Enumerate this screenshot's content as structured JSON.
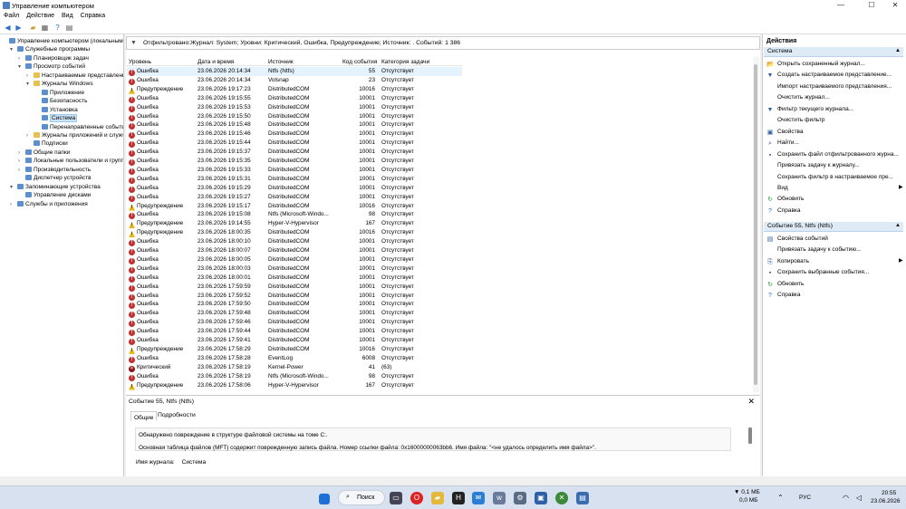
{
  "window": {
    "title": "Управление компьютером",
    "minimize": "—",
    "maximize": "☐",
    "close": "✕"
  },
  "menu": [
    "Файл",
    "Действие",
    "Вид",
    "Справка"
  ],
  "tree": [
    {
      "label": "Управление компьютером (локальным)",
      "level": 0,
      "arrow": "",
      "icon": "computer-icon"
    },
    {
      "label": "Служебные программы",
      "level": 1,
      "arrow": "▾",
      "icon": "tools-icon"
    },
    {
      "label": "Планировщик задач",
      "level": 2,
      "arrow": "›",
      "icon": "clock-icon"
    },
    {
      "label": "Просмотр событий",
      "level": 2,
      "arrow": "▾",
      "icon": "event-viewer-icon"
    },
    {
      "label": "Настраиваемые представления",
      "level": 3,
      "arrow": "›",
      "icon": "folder-icon"
    },
    {
      "label": "Журналы Windows",
      "level": 3,
      "arrow": "▾",
      "icon": "folder-icon"
    },
    {
      "label": "Приложение",
      "level": 4,
      "arrow": "",
      "icon": "log-icon"
    },
    {
      "label": "Безопасность",
      "level": 4,
      "arrow": "",
      "icon": "log-icon"
    },
    {
      "label": "Установка",
      "level": 4,
      "arrow": "",
      "icon": "log-icon"
    },
    {
      "label": "Система",
      "level": 4,
      "arrow": "",
      "icon": "log-icon",
      "selected": true
    },
    {
      "label": "Перенаправленные события",
      "level": 4,
      "arrow": "",
      "icon": "log-icon"
    },
    {
      "label": "Журналы приложений и служб",
      "level": 3,
      "arrow": "›",
      "icon": "folder-icon"
    },
    {
      "label": "Подписки",
      "level": 3,
      "arrow": "",
      "icon": "subscription-icon"
    },
    {
      "label": "Общие папки",
      "level": 2,
      "arrow": "›",
      "icon": "shared-folder-icon"
    },
    {
      "label": "Локальные пользователи и группы",
      "level": 2,
      "arrow": "›",
      "icon": "users-icon"
    },
    {
      "label": "Производительность",
      "level": 2,
      "arrow": "›",
      "icon": "performance-icon"
    },
    {
      "label": "Диспетчер устройств",
      "level": 2,
      "arrow": "",
      "icon": "device-manager-icon"
    },
    {
      "label": "Запоминающие устройства",
      "level": 1,
      "arrow": "▾",
      "icon": "storage-icon"
    },
    {
      "label": "Управление дисками",
      "level": 2,
      "arrow": "",
      "icon": "disk-icon"
    },
    {
      "label": "Службы и приложения",
      "level": 1,
      "arrow": "›",
      "icon": "services-icon"
    }
  ],
  "filter": {
    "text": "Отфильтровано:Журнал: System; Уровни: Критический, Ошибка, Предупреждение; Источник: . Событий: 1 386"
  },
  "columns": {
    "level": "Уровень",
    "datetime": "Дата и время",
    "source": "Источник",
    "code": "Код события",
    "category": "Категория задачи"
  },
  "rows": [
    {
      "level": "Ошибка",
      "type": "err",
      "dt": "23.06.2026 20:14:34",
      "src": "Ntfs (Ntfs)",
      "code": "55",
      "cat": "Отсутствует",
      "selected": true
    },
    {
      "level": "Ошибка",
      "type": "err",
      "dt": "23.06.2026 20:14:34",
      "src": "Volsnap",
      "code": "23",
      "cat": "Отсутствует"
    },
    {
      "level": "Предупреждение",
      "type": "warn",
      "dt": "23.06.2026 19:17:23",
      "src": "DistributedCOM",
      "code": "10016",
      "cat": "Отсутствует"
    },
    {
      "level": "Ошибка",
      "type": "err",
      "dt": "23.06.2026 19:15:55",
      "src": "DistributedCOM",
      "code": "10001",
      "cat": "Отсутствует"
    },
    {
      "level": "Ошибка",
      "type": "err",
      "dt": "23.06.2026 19:15:53",
      "src": "DistributedCOM",
      "code": "10001",
      "cat": "Отсутствует"
    },
    {
      "level": "Ошибка",
      "type": "err",
      "dt": "23.06.2026 19:15:50",
      "src": "DistributedCOM",
      "code": "10001",
      "cat": "Отсутствует"
    },
    {
      "level": "Ошибка",
      "type": "err",
      "dt": "23.06.2026 19:15:48",
      "src": "DistributedCOM",
      "code": "10001",
      "cat": "Отсутствует"
    },
    {
      "level": "Ошибка",
      "type": "err",
      "dt": "23.06.2026 19:15:46",
      "src": "DistributedCOM",
      "code": "10001",
      "cat": "Отсутствует"
    },
    {
      "level": "Ошибка",
      "type": "err",
      "dt": "23.06.2026 19:15:44",
      "src": "DistributedCOM",
      "code": "10001",
      "cat": "Отсутствует"
    },
    {
      "level": "Ошибка",
      "type": "err",
      "dt": "23.06.2026 19:15:37",
      "src": "DistributedCOM",
      "code": "10001",
      "cat": "Отсутствует"
    },
    {
      "level": "Ошибка",
      "type": "err",
      "dt": "23.06.2026 19:15:35",
      "src": "DistributedCOM",
      "code": "10001",
      "cat": "Отсутствует"
    },
    {
      "level": "Ошибка",
      "type": "err",
      "dt": "23.06.2026 19:15:33",
      "src": "DistributedCOM",
      "code": "10001",
      "cat": "Отсутствует"
    },
    {
      "level": "Ошибка",
      "type": "err",
      "dt": "23.06.2026 19:15:31",
      "src": "DistributedCOM",
      "code": "10001",
      "cat": "Отсутствует"
    },
    {
      "level": "Ошибка",
      "type": "err",
      "dt": "23.06.2026 19:15:29",
      "src": "DistributedCOM",
      "code": "10001",
      "cat": "Отсутствует"
    },
    {
      "level": "Ошибка",
      "type": "err",
      "dt": "23.06.2026 19:15:27",
      "src": "DistributedCOM",
      "code": "10001",
      "cat": "Отсутствует"
    },
    {
      "level": "Предупреждение",
      "type": "warn",
      "dt": "23.06.2026 19:15:17",
      "src": "DistributedCOM",
      "code": "10016",
      "cat": "Отсутствует"
    },
    {
      "level": "Ошибка",
      "type": "err",
      "dt": "23.06.2026 19:15:08",
      "src": "Ntfs (Microsoft-Windo...",
      "code": "98",
      "cat": "Отсутствует"
    },
    {
      "level": "Предупреждение",
      "type": "warn",
      "dt": "23.06.2026 19:14:55",
      "src": "Hyper-V-Hypervisor",
      "code": "167",
      "cat": "Отсутствует"
    },
    {
      "level": "Предупреждение",
      "type": "warn",
      "dt": "23.06.2026 18:00:35",
      "src": "DistributedCOM",
      "code": "10016",
      "cat": "Отсутствует"
    },
    {
      "level": "Ошибка",
      "type": "err",
      "dt": "23.06.2026 18:00:10",
      "src": "DistributedCOM",
      "code": "10001",
      "cat": "Отсутствует"
    },
    {
      "level": "Ошибка",
      "type": "err",
      "dt": "23.06.2026 18:00:07",
      "src": "DistributedCOM",
      "code": "10001",
      "cat": "Отсутствует"
    },
    {
      "level": "Ошибка",
      "type": "err",
      "dt": "23.06.2026 18:00:05",
      "src": "DistributedCOM",
      "code": "10001",
      "cat": "Отсутствует"
    },
    {
      "level": "Ошибка",
      "type": "err",
      "dt": "23.06.2026 18:00:03",
      "src": "DistributedCOM",
      "code": "10001",
      "cat": "Отсутствует"
    },
    {
      "level": "Ошибка",
      "type": "err",
      "dt": "23.06.2026 18:00:01",
      "src": "DistributedCOM",
      "code": "10001",
      "cat": "Отсутствует"
    },
    {
      "level": "Ошибка",
      "type": "err",
      "dt": "23.06.2026 17:59:59",
      "src": "DistributedCOM",
      "code": "10001",
      "cat": "Отсутствует"
    },
    {
      "level": "Ошибка",
      "type": "err",
      "dt": "23.06.2026 17:59:52",
      "src": "DistributedCOM",
      "code": "10001",
      "cat": "Отсутствует"
    },
    {
      "level": "Ошибка",
      "type": "err",
      "dt": "23.06.2026 17:59:50",
      "src": "DistributedCOM",
      "code": "10001",
      "cat": "Отсутствует"
    },
    {
      "level": "Ошибка",
      "type": "err",
      "dt": "23.06.2026 17:59:48",
      "src": "DistributedCOM",
      "code": "10001",
      "cat": "Отсутствует"
    },
    {
      "level": "Ошибка",
      "type": "err",
      "dt": "23.06.2026 17:59:46",
      "src": "DistributedCOM",
      "code": "10001",
      "cat": "Отсутствует"
    },
    {
      "level": "Ошибка",
      "type": "err",
      "dt": "23.06.2026 17:59:44",
      "src": "DistributedCOM",
      "code": "10001",
      "cat": "Отсутствует"
    },
    {
      "level": "Ошибка",
      "type": "err",
      "dt": "23.06.2026 17:59:41",
      "src": "DistributedCOM",
      "code": "10001",
      "cat": "Отсутствует"
    },
    {
      "level": "Предупреждение",
      "type": "warn",
      "dt": "23.06.2026 17:58:29",
      "src": "DistributedCOM",
      "code": "10016",
      "cat": "Отсутствует"
    },
    {
      "level": "Ошибка",
      "type": "err",
      "dt": "23.06.2026 17:58:28",
      "src": "EventLog",
      "code": "6008",
      "cat": "Отсутствует"
    },
    {
      "level": "Критический",
      "type": "crit",
      "dt": "23.06.2026 17:58:19",
      "src": "Kernel-Power",
      "code": "41",
      "cat": "(63)"
    },
    {
      "level": "Ошибка",
      "type": "err",
      "dt": "23.06.2026 17:58:19",
      "src": "Ntfs (Microsoft-Windo...",
      "code": "98",
      "cat": "Отсутствует"
    },
    {
      "level": "Предупреждение",
      "type": "warn",
      "dt": "23.06.2026 17:58:06",
      "src": "Hyper-V-Hypervisor",
      "code": "167",
      "cat": "Отсутствует"
    }
  ],
  "detail": {
    "header": "Событие 55, Ntfs (Ntfs)",
    "tab_general": "Общие",
    "tab_details": "Подробности",
    "line1": "Обнаружено повреждение в структуре файловой системы на томе C:.",
    "line2": "Основная таблица файлов (MFT) содержит поврежденную запись файла.  Номер ссылки файла: 0x16000000063bb6.  Имя файла: \"<не удалось определить имя файла>\".",
    "log_label": "Имя журнала:",
    "log_value": "Система"
  },
  "actions": {
    "title": "Действия",
    "section1": "Система",
    "items1": [
      {
        "label": "Открыть сохраненный журнал...",
        "icon": "open-log-icon",
        "glyph": "📂"
      },
      {
        "label": "Создать настраиваемое представление...",
        "icon": "create-view-icon",
        "glyph": "▼"
      },
      {
        "label": "Импорт настраиваемого представления...",
        "icon": "import-icon",
        "glyph": ""
      },
      {
        "label": "Очистить журнал...",
        "icon": "clear-log-icon",
        "glyph": ""
      },
      {
        "label": "Фильтр текущего журнала...",
        "icon": "filter-icon",
        "glyph": "▼"
      },
      {
        "label": "Очистить фильтр",
        "icon": "clear-filter-icon",
        "glyph": ""
      },
      {
        "label": "Свойства",
        "icon": "properties-icon",
        "glyph": "▣"
      },
      {
        "label": "Найти...",
        "icon": "find-icon",
        "glyph": "⌕"
      },
      {
        "label": "Сохранить файл отфильтрованного журна...",
        "icon": "save-icon",
        "glyph": "▪"
      },
      {
        "label": "Привязать задачу к журналу...",
        "icon": "attach-task-icon",
        "glyph": ""
      },
      {
        "label": "Сохранить фильтр в настраиваемое пре...",
        "icon": "save-filter-icon",
        "glyph": ""
      },
      {
        "label": "Вид",
        "icon": "view-icon",
        "glyph": "",
        "sub": "▶"
      },
      {
        "label": "Обновить",
        "icon": "refresh-icon",
        "glyph": "↻"
      },
      {
        "label": "Справка",
        "icon": "help-icon",
        "glyph": "?"
      }
    ],
    "section2": "Событие 55, Ntfs (Ntfs)",
    "items2": [
      {
        "label": "Свойства событий",
        "icon": "event-properties-icon",
        "glyph": "▤"
      },
      {
        "label": "Привязать задачу к событию...",
        "icon": "attach-task-icon",
        "glyph": ""
      },
      {
        "label": "Копировать",
        "icon": "copy-icon",
        "glyph": "⎘",
        "sub": "▶"
      },
      {
        "label": "Сохранить выбранные события...",
        "icon": "save-icon",
        "glyph": "▪"
      },
      {
        "label": "Обновить",
        "icon": "refresh-icon",
        "glyph": "↻"
      },
      {
        "label": "Справка",
        "icon": "help-icon",
        "glyph": "?"
      }
    ]
  },
  "taskbar": {
    "search": "Поиск",
    "network": "0,1 МБ",
    "network2": "0,0 МБ",
    "lang": "РУС",
    "time": "20:55",
    "date": "23.06.2026"
  },
  "colors": {
    "error": "#c0302f",
    "warning": "#e9b419",
    "critical": "#8f1212",
    "selection": "#e5f3ff",
    "section_bg": "#dfeaf7"
  }
}
